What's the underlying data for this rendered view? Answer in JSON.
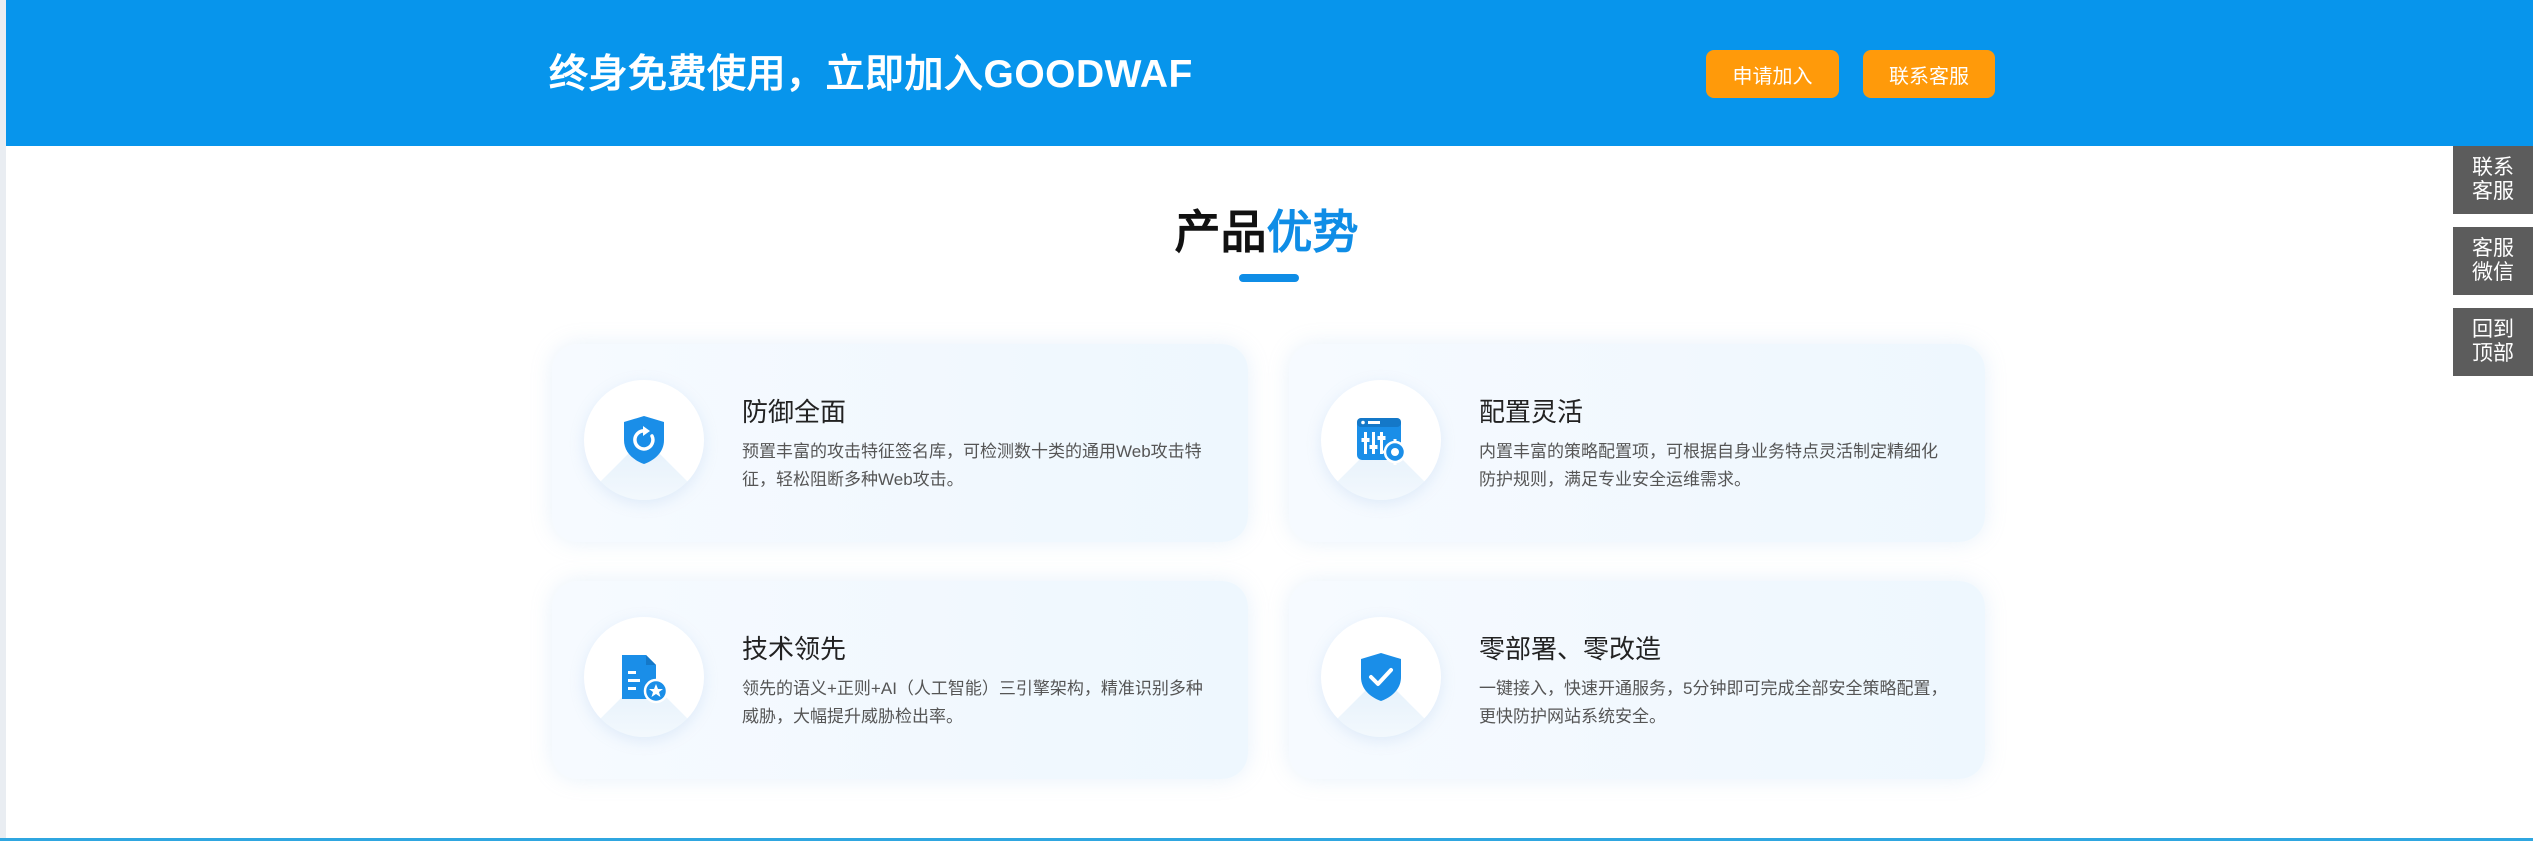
{
  "banner": {
    "title": "终身免费使用，立即加入GOODWAF",
    "apply_label": "申请加入",
    "contact_label": "联系客服"
  },
  "section": {
    "title_main": "产品",
    "title_accent": "优势"
  },
  "features": [
    {
      "icon": "shield-refresh-icon",
      "title": "防御全面",
      "desc": "预置丰富的攻击特征签名库，可检测数十类的通用Web攻击特征，轻松阻断多种Web攻击。"
    },
    {
      "icon": "config-gear-icon",
      "title": "配置灵活",
      "desc": "内置丰富的策略配置项，可根据自身业务特点灵活制定精细化防护规则，满足专业安全运维需求。"
    },
    {
      "icon": "document-star-icon",
      "title": "技术领先",
      "desc": "领先的语义+正则+AI（人工智能）三引擎架构，精准识别多种威胁，大幅提升威胁检出率。"
    },
    {
      "icon": "shield-check-icon",
      "title": "零部署、零改造",
      "desc": "一键接入，快速开通服务，5分钟即可完成全部安全策略配置，更快防护网站系统安全。"
    }
  ],
  "side_buttons": [
    {
      "label": "联系客服"
    },
    {
      "label": "客服微信"
    },
    {
      "label": "回到顶部"
    }
  ],
  "colors": {
    "banner_bg": "#0795ec",
    "button_orange": "#ff9a0a",
    "accent_blue": "#0f8de6",
    "side_button_bg": "#5c5c5c"
  }
}
